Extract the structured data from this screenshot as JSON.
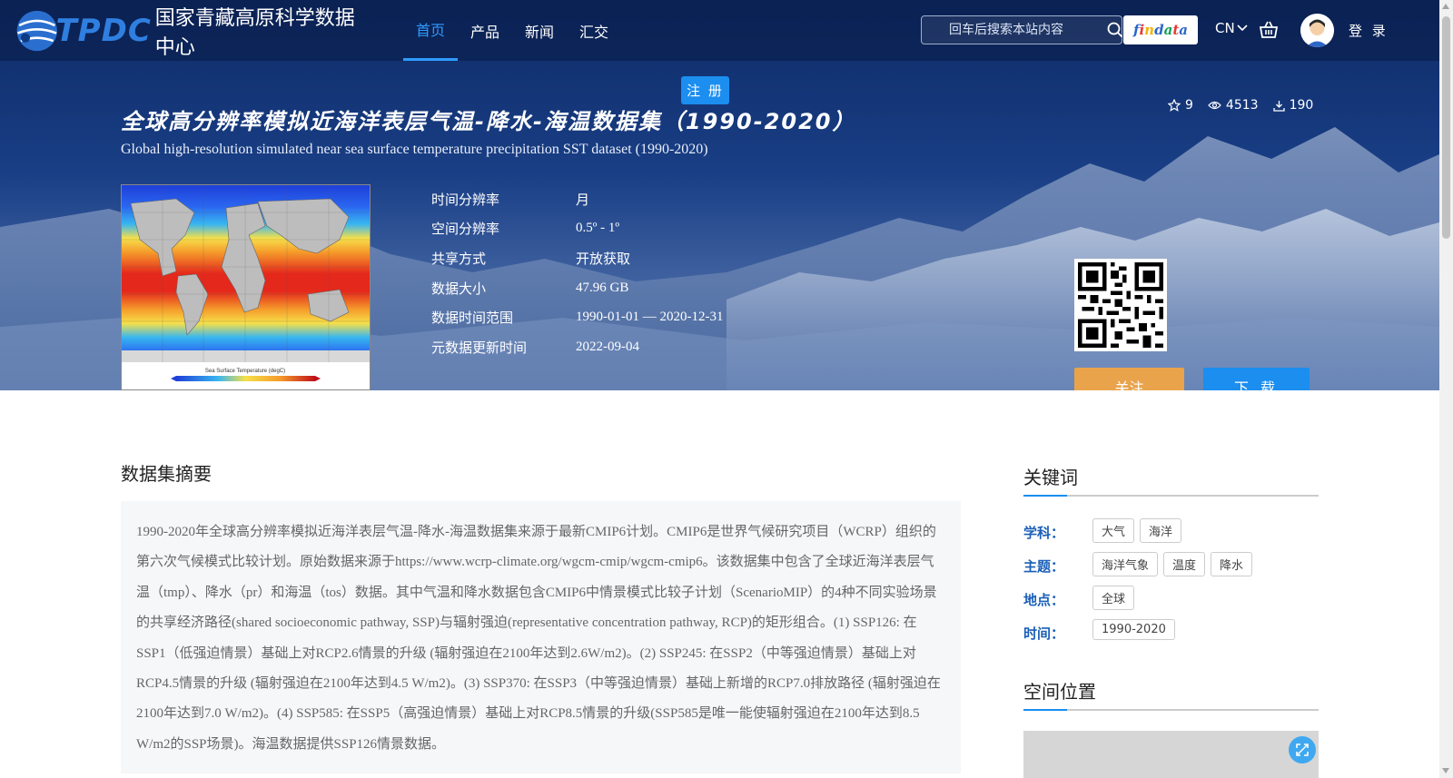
{
  "header": {
    "logo_abbr": "TPDC",
    "logo_name": "国家青藏高原科学数据中心",
    "nav": [
      {
        "label": "首页",
        "active": true
      },
      {
        "label": "产品",
        "active": false
      },
      {
        "label": "新闻",
        "active": false
      },
      {
        "label": "汇交",
        "active": false
      }
    ],
    "register_label": "注 册",
    "search_placeholder": "回车后搜索本站内容",
    "findata_letters": [
      "f",
      "i",
      "n",
      "d",
      "a",
      "t",
      "a"
    ],
    "findata_colors": [
      "#2c66c8",
      "#e53935",
      "#f4b400",
      "#2c66c8",
      "#0f9d58",
      "#e53935",
      "#2c66c8"
    ],
    "lang": "CN",
    "login_label": "登 录"
  },
  "dataset": {
    "title_cn": "全球高分辨率模拟近海洋表层气温-降水-海温数据集（1990-2020）",
    "title_en": "Global high-resolution simulated near sea surface temperature precipitation SST dataset (1990-2020)",
    "stats": {
      "stars": "9",
      "views": "4513",
      "downloads": "190"
    },
    "thumbnail_caption": "Sea Surface Temperature (degC)",
    "meta": [
      {
        "label": "时间分辨率",
        "value": "月"
      },
      {
        "label": "空间分辨率",
        "value": "0.5º - 1º"
      },
      {
        "label": "共享方式",
        "value": "开放获取"
      },
      {
        "label": "数据大小",
        "value": "47.96 GB"
      },
      {
        "label": "数据时间范围",
        "value": "1990-01-01 — 2020-12-31"
      },
      {
        "label": "元数据更新时间",
        "value": "2022-09-04"
      }
    ],
    "follow_label": "关注",
    "download_label": "下 载"
  },
  "abstract": {
    "title": "数据集摘要",
    "text": "1990-2020年全球高分辨率模拟近海洋表层气温-降水-海温数据集来源于最新CMIP6计划。CMIP6是世界气候研究项目（WCRP）组织的第六次气候模式比较计划。原始数据来源于https://www.wcrp-climate.org/wgcm-cmip/wgcm-cmip6。该数据集中包含了全球近海洋表层气温（tmp）、降水（pr）和海温（tos）数据。其中气温和降水数据包含CMIP6中情景模式比较子计划（ScenarioMIP）的4种不同实验场景的共享经济路径(shared socioeconomic pathway, SSP)与辐射强迫(representative concentration pathway, RCP)的矩形组合。(1) SSP126: 在SSP1（低强迫情景）基础上对RCP2.6情景的升级 (辐射强迫在2100年达到2.6W/m2)。(2) SSP245: 在SSP2（中等强迫情景）基础上对RCP4.5情景的升级 (辐射强迫在2100年达到4.5 W/m2)。(3) SSP370: 在SSP3（中等强迫情景）基础上新增的RCP7.0排放路径 (辐射强迫在2100年达到7.0 W/m2)。(4) SSP585: 在SSP5（高强迫情景）基础上对RCP8.5情景的升级(SSP585是唯一能使辐射强迫在2100年达到8.5 W/m2的SSP场景)。海温数据提供SSP126情景数据。"
  },
  "keywords": {
    "title": "关键词",
    "rows": [
      {
        "label": "学科：",
        "tags": [
          "大气",
          "海洋"
        ]
      },
      {
        "label": "主题：",
        "tags": [
          "海洋气象",
          "温度",
          "降水"
        ]
      },
      {
        "label": "地点：",
        "tags": [
          "全球"
        ]
      },
      {
        "label": "时间：",
        "tags": [
          "1990-2020"
        ]
      }
    ]
  },
  "location": {
    "title": "空间位置"
  }
}
